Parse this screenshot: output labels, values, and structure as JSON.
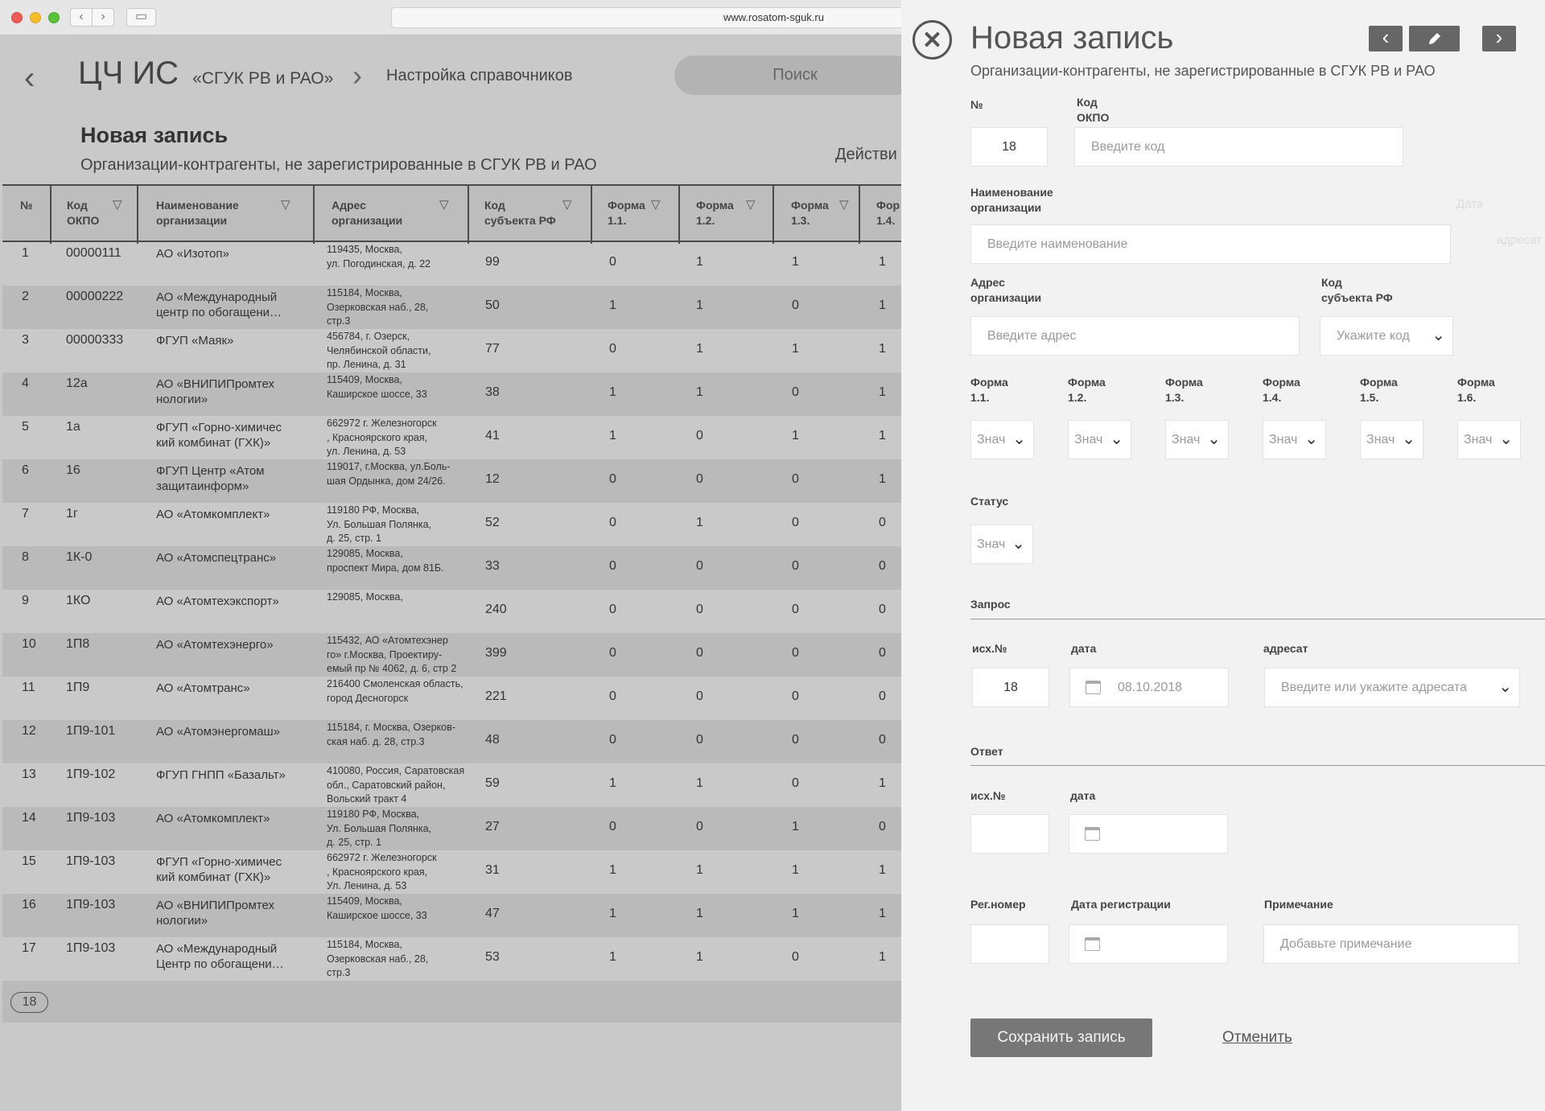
{
  "browser": {
    "url": "www.rosatom-sguk.ru"
  },
  "app": {
    "title": "ЦЧ ИС",
    "subtitle": "«СГУК РВ и РАО»",
    "breadcrumb": "Настройка справочников",
    "search_label": "Поиск",
    "page_title": "Новая запись",
    "page_subtitle": "Организации-контрагенты, не зарегистрированные в СГУК РВ и РАО",
    "actions_label": "Действи",
    "columns": [
      "№",
      "Код\nОКПО",
      "Наименование\nорганизации",
      "Адрес\nорганизации",
      "Код\nсубъекта РФ",
      "Форма\n1.1.",
      "Форма\n1.2.",
      "Форма\n1.3.",
      "Фор\n1.4."
    ],
    "rows": [
      [
        "1",
        "00000111",
        "АО «Изотоп»",
        "119435, Москва,\nул. Погодинская, д. 22",
        "99",
        "0",
        "1",
        "1",
        "1"
      ],
      [
        "2",
        "00000222",
        "АО «Международный\nцентр по обогащени…",
        "115184, Москва,\nОзерковская наб., 28,\nстр.3",
        "50",
        "1",
        "1",
        "0",
        "1"
      ],
      [
        "3",
        "00000333",
        "ФГУП «Маяк»",
        "456784, г. Озерск,\nЧелябинской области,\nпр. Ленина, д. 31",
        "77",
        "0",
        "1",
        "1",
        "1"
      ],
      [
        "4",
        "12а",
        "АО «ВНИПИПромтех\nнологии»",
        "115409, Москва,\nКаширское шоссе, 33",
        "38",
        "1",
        "1",
        "0",
        "1"
      ],
      [
        "5",
        "1а",
        "ФГУП «Горно-химичес\nкий комбинат (ГХК)»",
        "662972 г. Железногорск\n, Красноярского края,\nул. Ленина, д. 53",
        "41",
        "1",
        "0",
        "1",
        "1"
      ],
      [
        "6",
        "16",
        "ФГУП Центр «Атом\nзащитаинформ»",
        "119017, г.Москва, ул.Боль-\nшая Ордынка, дом 24/26.",
        "12",
        "0",
        "0",
        "0",
        "1"
      ],
      [
        "7",
        "1г",
        "АО «Атомкомплект»",
        "119180 РФ, Москва,\nУл. Большая Полянка,\nд. 25, стр. 1",
        "52",
        "0",
        "1",
        "0",
        "0"
      ],
      [
        "8",
        "1К-0",
        "АО «Атомспецтранс»",
        "129085, Москва,\nпроспект Мира, дом 81Б.",
        "33",
        "0",
        "0",
        "0",
        "0"
      ],
      [
        "9",
        "1КО",
        "АО «Атомтехэкспорт»",
        "129085, Москва,",
        "240",
        "0",
        "0",
        "0",
        "0"
      ],
      [
        "10",
        "1П8",
        "АО «Атомтехэнерго»",
        "115432, АО «Атомтехэнер\nго» г.Москва, Проектиру-\nемый пр № 4062, д. 6, стр 2",
        "399",
        "0",
        "0",
        "0",
        "0"
      ],
      [
        "11",
        "1П9",
        "АО «Атомтранс»",
        "216400 Смоленская область,\nгород Десногорск",
        "221",
        "0",
        "0",
        "0",
        "0"
      ],
      [
        "12",
        "1П9-101",
        "АО «Атомэнергомаш»",
        "115184, г. Москва, Озерков-\nская наб. д. 28, стр.3",
        "48",
        "0",
        "0",
        "0",
        "0"
      ],
      [
        "13",
        "1П9-102",
        "ФГУП ГНПП «Базальт»",
        "410080, Россия, Саратовская\nобл., Саратовский район,\nВольский тракт 4",
        "59",
        "1",
        "1",
        "0",
        "1"
      ],
      [
        "14",
        "1П9-103",
        "АО «Атомкомплект»",
        "119180 РФ, Москва,\nУл. Большая Полянка,\nд. 25, стр. 1",
        "27",
        "0",
        "0",
        "1",
        "0"
      ],
      [
        "15",
        "1П9-103",
        "ФГУП «Горно-химичес\nкий комбинат (ГХК)»",
        "662972 г. Железногорск\n, Красноярского края,\nУл. Ленина, д. 53",
        "31",
        "1",
        "1",
        "1",
        "1"
      ],
      [
        "16",
        "1П9-103",
        "АО «ВНИПИПромтех\nнологии»",
        "115409, Москва,\nКаширское шоссе, 33",
        "47",
        "1",
        "1",
        "1",
        "1"
      ],
      [
        "17",
        "1П9-103",
        "АО «Международный\nЦентр по обогащени…",
        "115184, Москва,\nОзерковская наб., 28,\nстр.3",
        "53",
        "1",
        "1",
        "0",
        "1"
      ]
    ],
    "page_number": "18"
  },
  "panel": {
    "title": "Новая запись",
    "subtitle": "Организации-контрагенты, не зарегистрированные в СГУК РВ и РАО",
    "labels": {
      "num": "№",
      "okpo": "Код\nОКПО",
      "name": "Наименование\nорганизации",
      "address": "Адрес\nорганизации",
      "subject": "Код\nсубъекта РФ",
      "status": "Статус",
      "request": "Запрос",
      "req_out_num": "исх.№",
      "req_date": "дата",
      "req_addressee": "адресат",
      "answer": "Ответ",
      "ans_out_num": "исх.№",
      "ans_date": "дата",
      "reg_num": "Рег.номер",
      "reg_date": "Дата регистрации",
      "note": "Примечание"
    },
    "forms": [
      {
        "label": "Форма\n1.1.",
        "placeholder": "Знач"
      },
      {
        "label": "Форма\n1.2.",
        "placeholder": "Знач"
      },
      {
        "label": "Форма\n1.3.",
        "placeholder": "Знач"
      },
      {
        "label": "Форма\n1.4.",
        "placeholder": "Знач"
      },
      {
        "label": "Форма\n1.5.",
        "placeholder": "Знач"
      },
      {
        "label": "Форма\n1.6.",
        "placeholder": "Знач"
      }
    ],
    "values": {
      "num": "18",
      "req_out_num": "18",
      "req_date": "08.10.2018"
    },
    "placeholders": {
      "okpo": "Введите код",
      "name": "Введите наименование",
      "address": "Введите адрес",
      "subject": "Укажите код",
      "status": "Знач",
      "addressee": "Введите или укажите адресата",
      "note": "Добавьте примечание"
    },
    "save_label": "Сохранить запись",
    "cancel_label": "Отменить"
  }
}
